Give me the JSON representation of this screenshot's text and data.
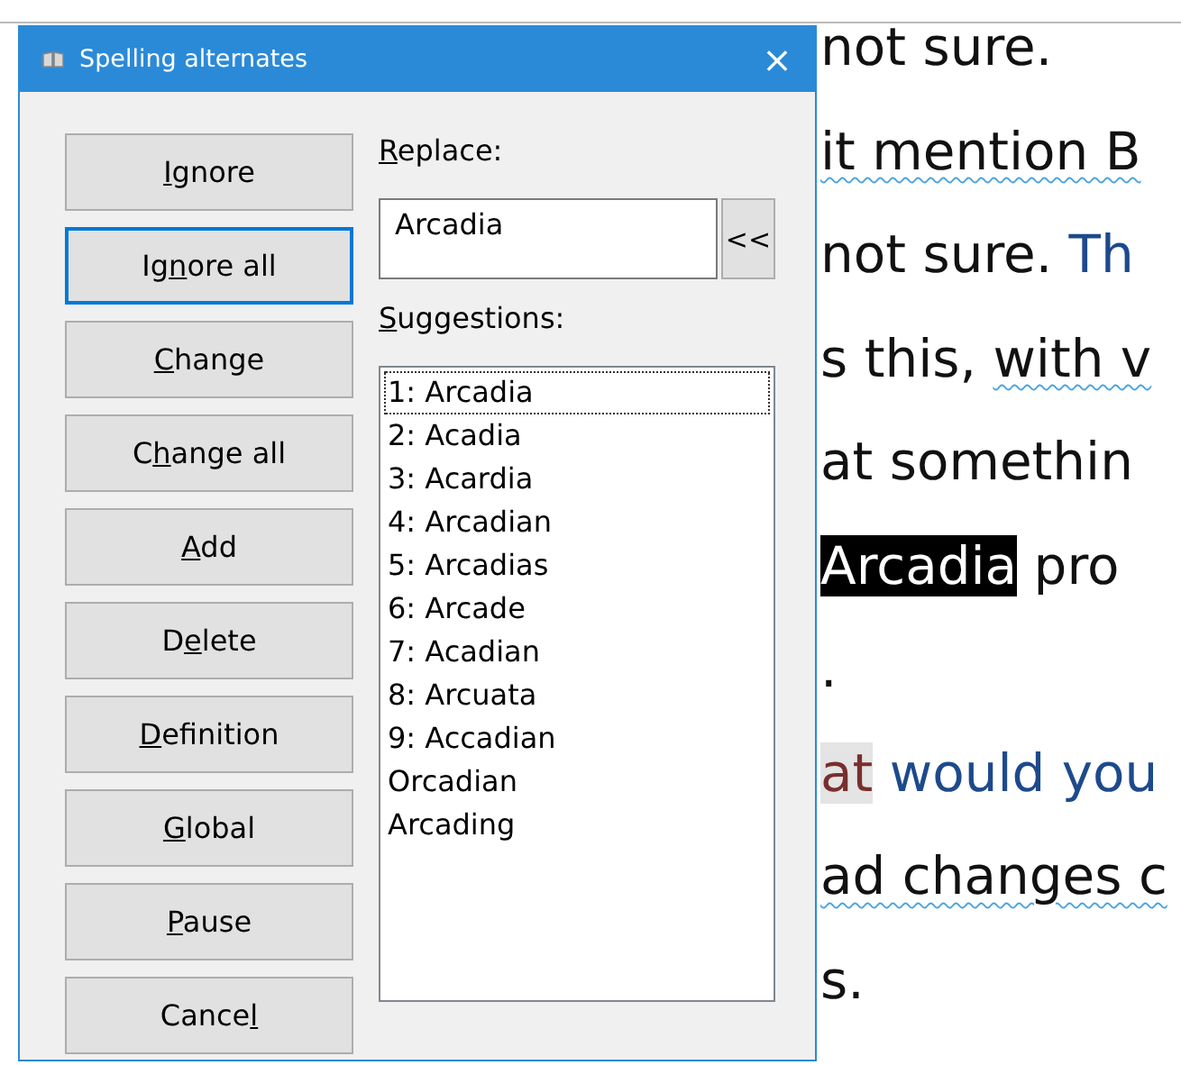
{
  "document": {
    "lines": [
      {
        "segments": [
          {
            "text": "not sure.",
            "kind": "plain",
            "flagged": false
          }
        ]
      },
      {
        "segments": [
          {
            "text": "it mention B",
            "kind": "plain",
            "flagged": true
          }
        ]
      },
      {
        "segments": [
          {
            "text": "not sure.  ",
            "kind": "plain",
            "flagged": false
          },
          {
            "text": "Th",
            "kind": "blue",
            "flagged": false
          }
        ]
      },
      {
        "segments": [
          {
            "text": "s this, ",
            "kind": "plain",
            "flagged": false
          },
          {
            "text": "with v",
            "kind": "plain",
            "flagged": true
          }
        ]
      },
      {
        "segments": [
          {
            "text": "at somethin",
            "kind": "plain",
            "flagged": false
          }
        ]
      },
      {
        "segments": [
          {
            "text": "Arcadia",
            "kind": "selected",
            "flagged": false
          },
          {
            "text": " pro",
            "kind": "plain",
            "flagged": false
          }
        ]
      },
      {
        "segments": [
          {
            "text": ".",
            "kind": "plain",
            "flagged": false
          }
        ]
      },
      {
        "segments": [
          {
            "text": "at",
            "kind": "marked",
            "flagged": false
          },
          {
            "text": " would you",
            "kind": "blue",
            "flagged": false
          }
        ]
      },
      {
        "segments": [
          {
            "text": "ad changes c",
            "kind": "plain",
            "flagged": true
          }
        ]
      },
      {
        "segments": [
          {
            "text": "s.",
            "kind": "plain",
            "flagged": false
          }
        ]
      }
    ]
  },
  "dialog": {
    "title": "Spelling alternates",
    "close": "×",
    "buttons": [
      {
        "key": "I",
        "after": "gnore",
        "focused": false
      },
      {
        "before": "Ig",
        "key": "n",
        "after": "ore all",
        "focused": true
      },
      {
        "key": "C",
        "after": "hange",
        "focused": false
      },
      {
        "before": "C",
        "key": "h",
        "after": "ange all",
        "focused": false
      },
      {
        "key": "A",
        "after": "dd",
        "focused": false
      },
      {
        "before": "D",
        "key": "e",
        "after": "lete",
        "focused": false
      },
      {
        "key": "D",
        "after": "efinition",
        "focused": false
      },
      {
        "key": "G",
        "after": "lobal",
        "focused": false
      },
      {
        "key": "P",
        "after": "ause",
        "focused": false
      },
      {
        "before": "Cance",
        "key": "l",
        "focused": false
      }
    ],
    "replace_label": {
      "key": "R",
      "after": "eplace:"
    },
    "replace_value": "Arcadia",
    "restore_button": "<<",
    "suggestions_label": {
      "key": "S",
      "after": "uggestions:"
    },
    "suggestions": [
      {
        "text": "1: Arcadia",
        "selected": true
      },
      {
        "text": "2: Acadia",
        "selected": false
      },
      {
        "text": "3: Acardia",
        "selected": false
      },
      {
        "text": "4: Arcadian",
        "selected": false
      },
      {
        "text": "5: Arcadias",
        "selected": false
      },
      {
        "text": "6: Arcade",
        "selected": false
      },
      {
        "text": "7: Acadian",
        "selected": false
      },
      {
        "text": "8: Arcuata",
        "selected": false
      },
      {
        "text": "9: Accadian",
        "selected": false
      },
      {
        "text": "Orcadian",
        "selected": false
      },
      {
        "text": "Arcading",
        "selected": false
      }
    ]
  }
}
